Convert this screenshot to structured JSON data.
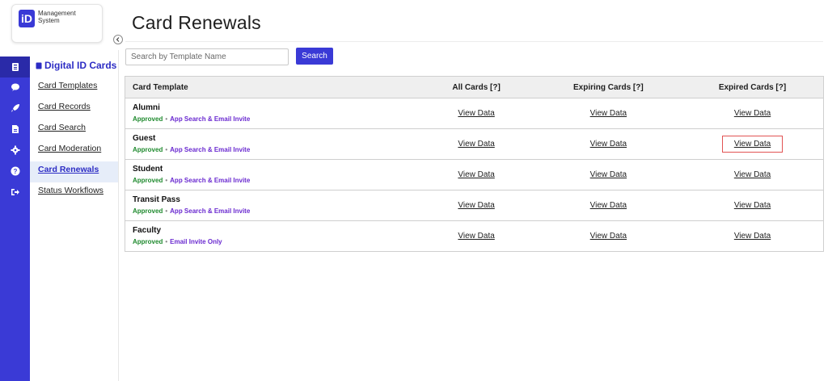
{
  "brand": {
    "mark": "iD",
    "name_line1": "Management",
    "name_line2": "System"
  },
  "rail": [
    {
      "icon": "id-card-icon",
      "active": true
    },
    {
      "icon": "chat-icon",
      "active": false
    },
    {
      "icon": "rocket-icon",
      "active": false
    },
    {
      "icon": "document-icon",
      "active": false
    },
    {
      "icon": "gear-icon",
      "active": false
    },
    {
      "icon": "help-icon",
      "active": false
    },
    {
      "icon": "logout-icon",
      "active": false
    }
  ],
  "sidebar": {
    "header": "Digital ID Cards",
    "items": [
      {
        "label": "Card Templates",
        "active": false
      },
      {
        "label": "Card Records",
        "active": false
      },
      {
        "label": "Card Search",
        "active": false
      },
      {
        "label": "Card Moderation",
        "active": false
      },
      {
        "label": "Card Renewals",
        "active": true
      },
      {
        "label": "Status Workflows",
        "active": false
      }
    ]
  },
  "page": {
    "title": "Card Renewals"
  },
  "search": {
    "placeholder": "Search by Template Name",
    "button_label": "Search"
  },
  "table": {
    "columns": [
      "Card Template",
      "All Cards [?]",
      "Expiring Cards [?]",
      "Expired Cards [?]"
    ],
    "rows": [
      {
        "name": "Alumni",
        "status": "Approved",
        "method": "App Search & Email Invite",
        "all": "View Data",
        "expiring": "View Data",
        "expired": "View Data",
        "highlight": false
      },
      {
        "name": "Guest",
        "status": "Approved",
        "method": "App Search & Email Invite",
        "all": "View Data",
        "expiring": "View Data",
        "expired": "View Data",
        "highlight": true
      },
      {
        "name": "Student",
        "status": "Approved",
        "method": "App Search & Email Invite",
        "all": "View Data",
        "expiring": "View Data",
        "expired": "View Data",
        "highlight": false
      },
      {
        "name": "Transit Pass",
        "status": "Approved",
        "method": "App Search & Email Invite",
        "all": "View Data",
        "expiring": "View Data",
        "expired": "View Data",
        "highlight": false
      },
      {
        "name": "Faculty",
        "status": "Approved",
        "method": "Email Invite Only",
        "all": "View Data",
        "expiring": "View Data",
        "expired": "View Data",
        "highlight": false
      }
    ]
  },
  "colors": {
    "accent": "#3a3ad6",
    "approved": "#1f8a2e",
    "method": "#6a2ad0",
    "highlight_border": "#e15353"
  }
}
